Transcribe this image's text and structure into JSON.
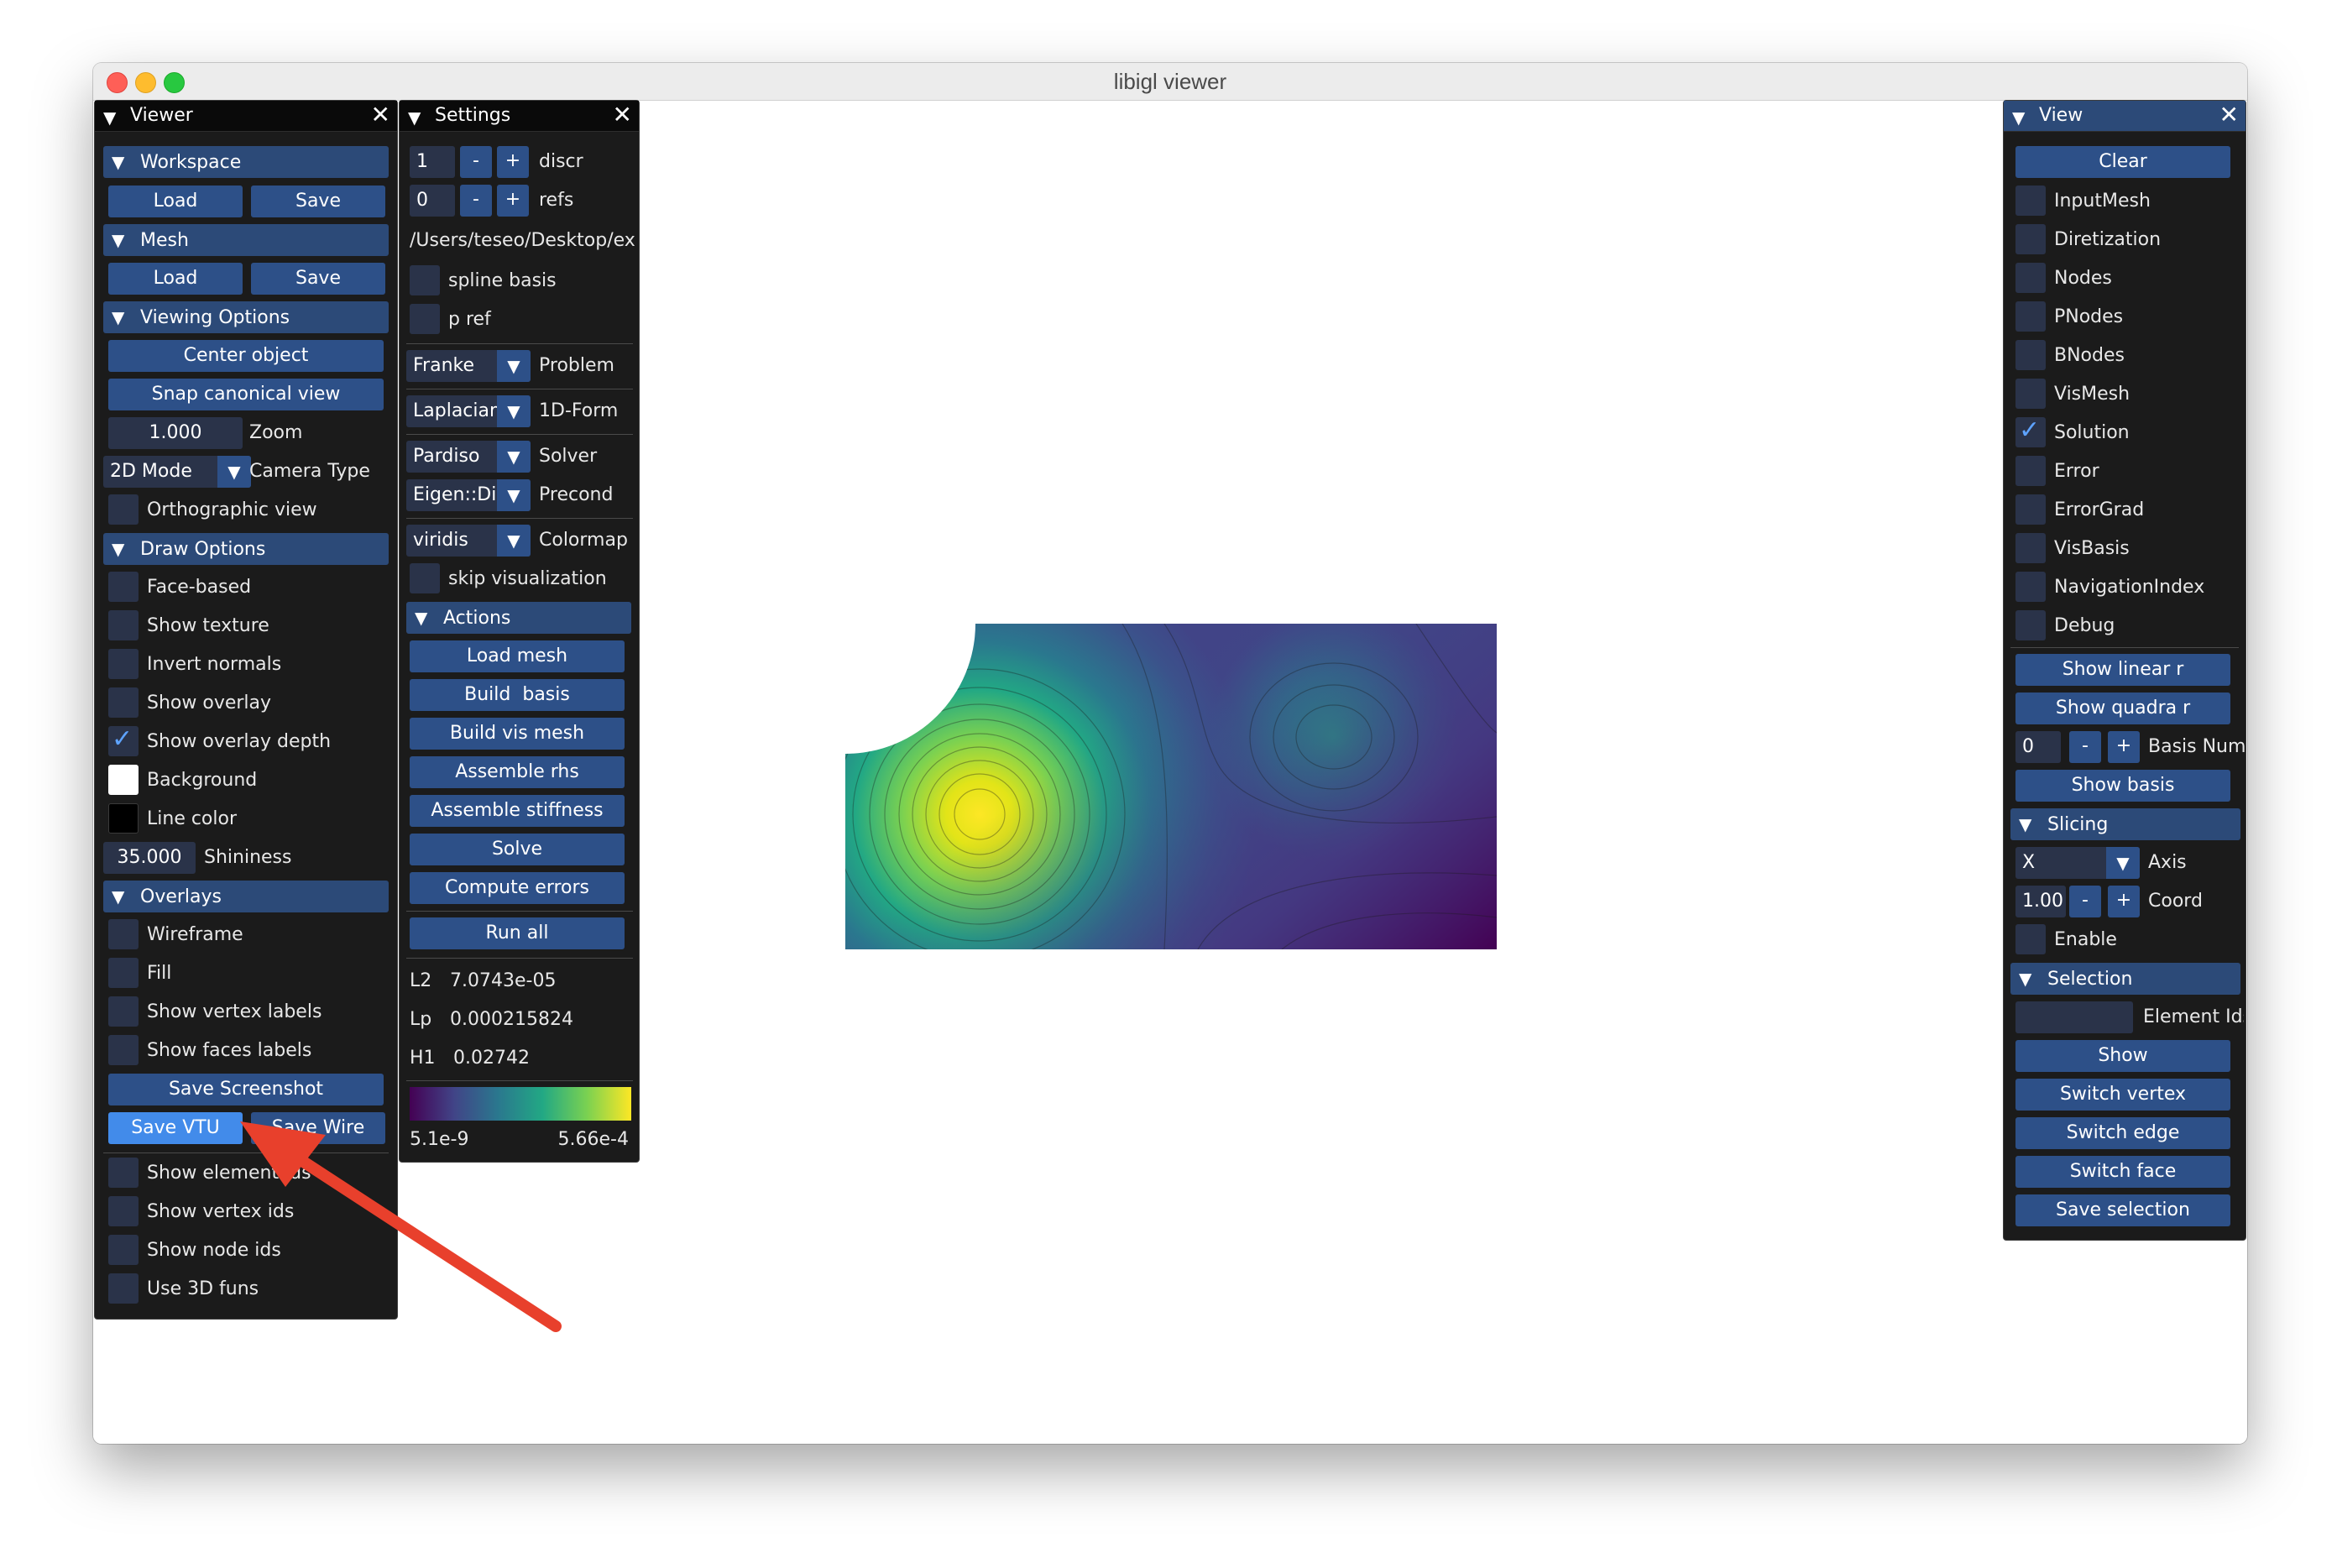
{
  "window": {
    "title": "libigl viewer"
  },
  "viewer_panel": {
    "title": "Viewer",
    "workspace": {
      "header": "Workspace",
      "load": "Load",
      "save": "Save"
    },
    "mesh": {
      "header": "Mesh",
      "load": "Load",
      "save": "Save"
    },
    "viewing_options": {
      "header": "Viewing Options",
      "center_object": "Center object",
      "snap_canonical_view": "Snap canonical view",
      "zoom_value": "1.000",
      "zoom_label": "Zoom",
      "camera_mode": "2D Mode",
      "camera_label": "Camera Type",
      "orthographic_label": "Orthographic view",
      "orthographic_checked": false
    },
    "draw_options": {
      "header": "Draw Options",
      "items": [
        {
          "label": "Face-based",
          "checked": false
        },
        {
          "label": "Show texture",
          "checked": false
        },
        {
          "label": "Invert normals",
          "checked": false
        },
        {
          "label": "Show overlay",
          "checked": false
        },
        {
          "label": "Show overlay depth",
          "checked": true
        }
      ],
      "background_label": "Background",
      "background_color": "#ffffff",
      "line_color_label": "Line color",
      "line_color": "#000000",
      "shininess_value": "35.000",
      "shininess_label": "Shininess"
    },
    "overlays": {
      "header": "Overlays",
      "items": [
        {
          "label": "Wireframe",
          "checked": false
        },
        {
          "label": "Fill",
          "checked": false
        },
        {
          "label": "Show vertex labels",
          "checked": false
        },
        {
          "label": "Show faces labels",
          "checked": false
        }
      ]
    },
    "save_screenshot": "Save Screenshot",
    "save_vtu": "Save VTU",
    "save_wire": "Save Wire",
    "bottom_items": [
      {
        "label": "Show element ids",
        "checked": false
      },
      {
        "label": "Show vertex ids",
        "checked": false
      },
      {
        "label": "Show node ids",
        "checked": false
      },
      {
        "label": "Use 3D funs",
        "checked": false
      }
    ]
  },
  "settings_panel": {
    "title": "Settings",
    "discr_value": "1",
    "discr_label": "discr",
    "refs_value": "0",
    "refs_label": "refs",
    "minus": "-",
    "plus": "+",
    "path": "/Users/teseo/Desktop/exp",
    "spline_basis_label": "spline basis",
    "p_ref_label": "p ref",
    "problem_value": "Franke",
    "problem_label": "Problem",
    "form_value": "Laplacian",
    "form_label": "1D-Form",
    "solver_value": "Pardiso",
    "solver_label": "Solver",
    "precond_value": "Eigen::Dia",
    "precond_label": "Precond",
    "colormap_value": "viridis",
    "colormap_label": "Colormap",
    "skip_visualization_label": "skip visualization",
    "actions_header": "Actions",
    "actions": [
      "Load mesh",
      "Build  basis",
      "Build vis mesh",
      "Assemble rhs",
      "Assemble stiffness",
      "Solve",
      "Compute errors"
    ],
    "run_all": "Run all",
    "errors": [
      {
        "name": "L2",
        "value": "7.0743e-05"
      },
      {
        "name": "Lp",
        "value": "0.000215824"
      },
      {
        "name": "H1",
        "value": "0.02742"
      }
    ],
    "colorbar_min": "5.1e-9",
    "colorbar_max": "5.66e-4"
  },
  "view_panel": {
    "title": "View",
    "clear": "Clear",
    "layers": [
      {
        "label": "InputMesh",
        "checked": false
      },
      {
        "label": "Diretization",
        "checked": false
      },
      {
        "label": "Nodes",
        "checked": false
      },
      {
        "label": "PNodes",
        "checked": false
      },
      {
        "label": "BNodes",
        "checked": false
      },
      {
        "label": "VisMesh",
        "checked": false
      },
      {
        "label": "Solution",
        "checked": true
      },
      {
        "label": "Error",
        "checked": false
      },
      {
        "label": "ErrorGrad",
        "checked": false
      },
      {
        "label": "VisBasis",
        "checked": false
      },
      {
        "label": "NavigationIndex",
        "checked": false
      },
      {
        "label": "Debug",
        "checked": false
      }
    ],
    "show_linear": "Show linear r",
    "show_quadra": "Show quadra r",
    "basis_num_value": "0",
    "basis_num_label": "Basis Num",
    "minus": "-",
    "plus": "+",
    "show_basis": "Show basis",
    "slicing_header": "Slicing",
    "axis_value": "X",
    "axis_label": "Axis",
    "coord_value": "1.00",
    "coord_label": "Coord",
    "enable_label": "Enable",
    "selection_header": "Selection",
    "element_ids_value": "",
    "element_ids_label": "Element Ids",
    "selection_buttons": [
      "Show",
      "Switch vertex",
      "Switch edge",
      "Switch face",
      "Save selection"
    ]
  },
  "colors": {
    "panel_bg": "#1b1b1b",
    "header_bg": "#2c4a78",
    "button_bg": "#2d5088",
    "button_active": "#428bea",
    "arrow": "#e8402c"
  },
  "icons": {
    "collapse": "triangle-down-icon",
    "close": "close-icon",
    "check": "checkmark-icon"
  }
}
